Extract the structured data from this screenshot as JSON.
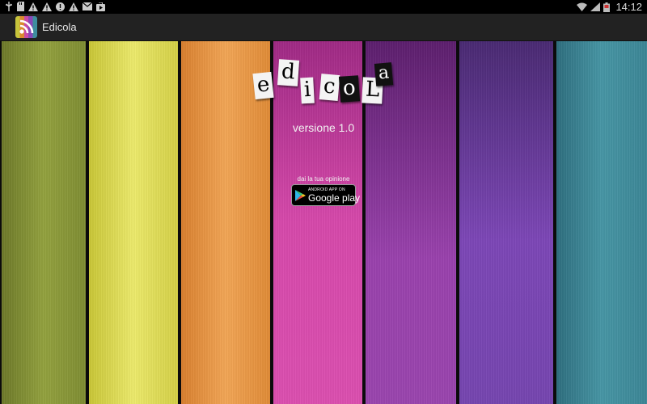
{
  "status_bar": {
    "clock": "14:12",
    "left_icons": [
      "usb-icon",
      "sd-card-icon",
      "warning-icon",
      "warning-icon",
      "alert-icon",
      "warning-icon",
      "mail-icon",
      "play-store-icon"
    ],
    "right_icons": [
      "wifi-icon",
      "signal-icon",
      "battery-icon"
    ]
  },
  "action_bar": {
    "title": "Edicola",
    "icon": "rss-newspaper-icon"
  },
  "main": {
    "logo_letters": [
      "e",
      "d",
      "i",
      "c",
      "o",
      "L",
      "a"
    ],
    "version": "versione 1.0",
    "opinion": "dai la tua opinione",
    "play_badge": {
      "top_text": "ANDROID APP ON",
      "main_text": "Google play"
    }
  },
  "colors": {
    "stripe_olive": "#8a9a3a",
    "stripe_yellow": "#e2df5a",
    "stripe_orange": "#e89a45",
    "stripe_magenta": "#d548a9",
    "stripe_purple": "#8f3ea4",
    "stripe_violet": "#7a44b2",
    "stripe_teal": "#3f8f9d"
  }
}
